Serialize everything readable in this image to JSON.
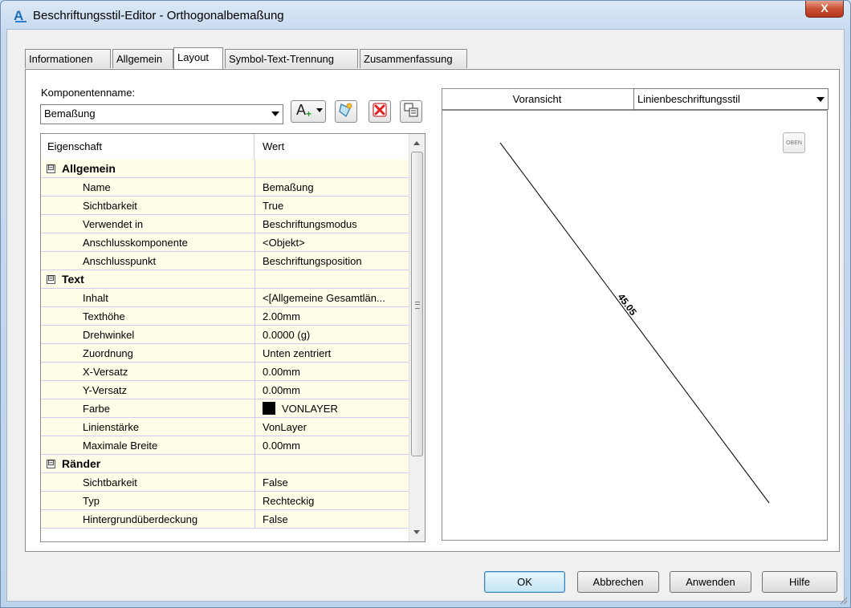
{
  "window": {
    "title": "Beschriftungsstil-Editor - Orthogonalbemaßung",
    "close_label": "X"
  },
  "tabs": [
    {
      "label": "Informationen"
    },
    {
      "label": "Allgemein"
    },
    {
      "label": "Layout"
    },
    {
      "label": "Symbol-Text-Trennung"
    },
    {
      "label": "Zusammenfassung"
    }
  ],
  "component": {
    "label": "Komponentenname:",
    "value": "Bemaßung"
  },
  "grid": {
    "header": {
      "property": "Eigenschaft",
      "value": "Wert"
    },
    "rows": [
      {
        "type": "cat",
        "key": "Allgemein",
        "toggle": "⊟"
      },
      {
        "key": "Name",
        "value": "Bemaßung"
      },
      {
        "key": "Sichtbarkeit",
        "value": "True"
      },
      {
        "key": "Verwendet in",
        "value": "Beschriftungsmodus"
      },
      {
        "key": "Anschlusskomponente",
        "value": "<Objekt>"
      },
      {
        "key": "Anschlusspunkt",
        "value": "Beschriftungsposition"
      },
      {
        "type": "cat",
        "key": "Text",
        "toggle": "⊟"
      },
      {
        "key": "Inhalt",
        "value": "<[Allgemeine Gesamtlän..."
      },
      {
        "key": "Texthöhe",
        "value": "2.00mm"
      },
      {
        "key": "Drehwinkel",
        "value": "0.0000 (g)"
      },
      {
        "key": "Zuordnung",
        "value": "Unten zentriert"
      },
      {
        "key": "X-Versatz",
        "value": "0.00mm"
      },
      {
        "key": "Y-Versatz",
        "value": "0.00mm"
      },
      {
        "key": "Farbe",
        "value": "VONLAYER",
        "swatch": "#000000"
      },
      {
        "key": "Linienstärke",
        "value": "VonLayer"
      },
      {
        "key": "Maximale Breite",
        "value": "0.00mm"
      },
      {
        "type": "cat",
        "key": "Ränder",
        "toggle": "⊟"
      },
      {
        "key": "Sichtbarkeit",
        "value": "False"
      },
      {
        "key": "Typ",
        "value": "Rechteckig"
      },
      {
        "key": "Hintergrundüberdeckung",
        "value": "False"
      }
    ]
  },
  "preview": {
    "label": "Voransicht",
    "style_select": "Linienbeschriftungsstil",
    "dimension_text": "45.05",
    "view_cube_label": "OBEN"
  },
  "buttons": {
    "ok": "OK",
    "cancel": "Abbrechen",
    "apply": "Anwenden",
    "help": "Hilfe"
  },
  "colors": {
    "accent": "#1c6fb7",
    "grid_row_bg": "#fffce8",
    "delete_red": "#e02020"
  }
}
